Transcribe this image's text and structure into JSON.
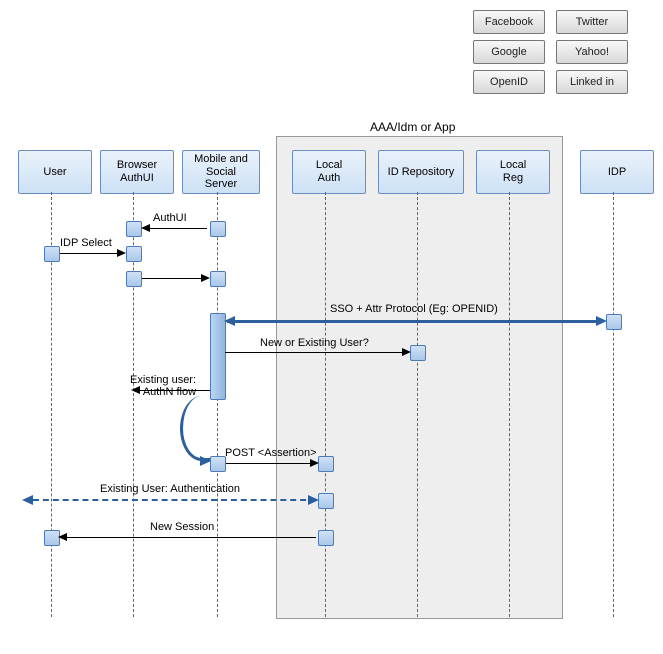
{
  "idp_buttons": {
    "facebook": "Facebook",
    "twitter": "Twitter",
    "google": "Google",
    "yahoo": "Yahoo!",
    "openid": "OpenID",
    "linkedin": "Linked in"
  },
  "container": {
    "label": "AAA/Idm or App"
  },
  "participants": {
    "user": "User",
    "browser": "Browser\nAuthUI",
    "mss": "Mobile and\nSocial\nServer",
    "local_auth": "Local\nAuth",
    "id_repo": "ID Repository",
    "local_reg": "Local\nReg",
    "idp": "IDP"
  },
  "messages": {
    "authui": "AuthUI",
    "idp_select": "IDP Select",
    "sso": "SSO + Attr Protocol (Eg: OPENID)",
    "new_or_existing": "New or Existing User?",
    "existing_user_flow": "Existing user:\nAuthN flow",
    "post_assertion": "POST <Assertion>",
    "existing_auth": "Existing User: Authentication",
    "new_session": "New Session"
  },
  "chart_data": {
    "type": "sequence-diagram",
    "container": {
      "label": "AAA/Idm or App",
      "participants": [
        "Local Auth",
        "ID Repository",
        "Local Reg"
      ]
    },
    "participants": [
      "User",
      "Browser AuthUI",
      "Mobile and Social Server",
      "Local Auth",
      "ID Repository",
      "Local Reg",
      "IDP"
    ],
    "idp_options": [
      "Facebook",
      "Twitter",
      "Google",
      "Yahoo!",
      "OpenID",
      "Linked in"
    ],
    "messages": [
      {
        "from": "Mobile and Social Server",
        "to": "Browser AuthUI",
        "label": "AuthUI",
        "style": "solid"
      },
      {
        "from": "User",
        "to": "Browser AuthUI",
        "label": "IDP Select",
        "style": "solid"
      },
      {
        "from": "Browser AuthUI",
        "to": "Mobile and Social Server",
        "label": "",
        "style": "solid"
      },
      {
        "from": "Mobile and Social Server",
        "to": "IDP",
        "label": "SSO + Attr Protocol (Eg: OPENID)",
        "style": "solid-thick",
        "bidirectional": true
      },
      {
        "from": "Mobile and Social Server",
        "to": "ID Repository",
        "label": "New or Existing User?",
        "style": "solid"
      },
      {
        "from": "Mobile and Social Server",
        "to": "Mobile and Social Server",
        "label": "Existing user: AuthN flow",
        "style": "self-thick"
      },
      {
        "from": "Mobile and Social Server",
        "to": "Local Auth",
        "label": "POST <Assertion>",
        "style": "solid"
      },
      {
        "from": "User",
        "to": "Local Auth",
        "label": "Existing User: Authentication",
        "style": "dashed-thick",
        "bidirectional": true
      },
      {
        "from": "Local Auth",
        "to": "User",
        "label": "New Session",
        "style": "solid"
      }
    ]
  }
}
